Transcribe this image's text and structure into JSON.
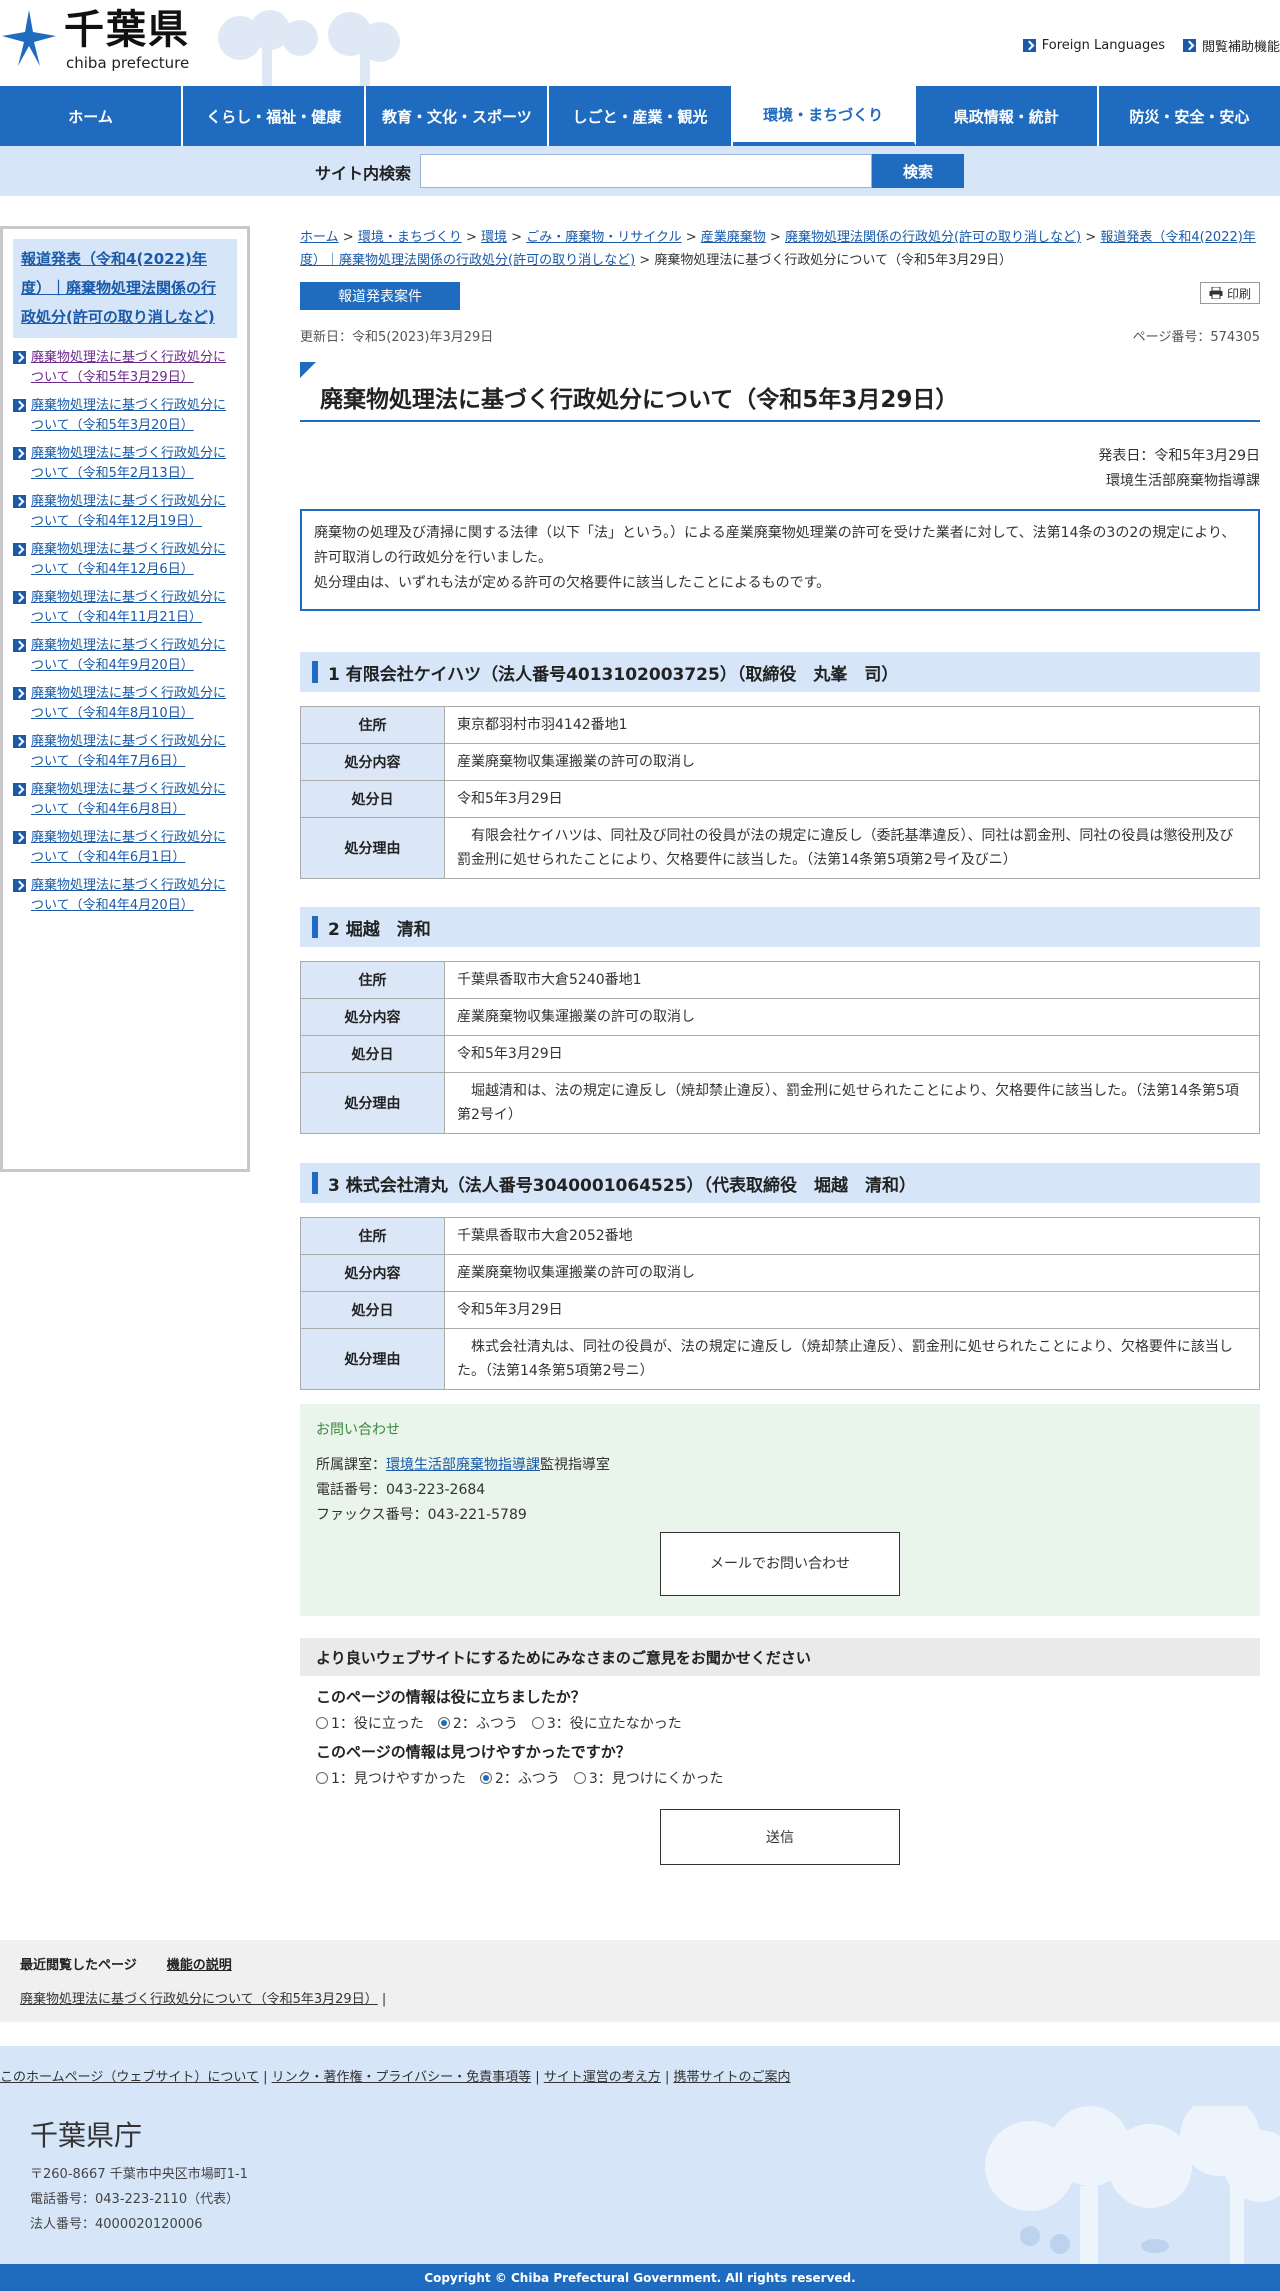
{
  "header": {
    "logo_ja": "千葉県",
    "logo_en": "chiba prefecture",
    "links": [
      "Foreign Languages",
      "閲覧補助機能"
    ]
  },
  "nav": {
    "items": [
      {
        "label": "ホーム"
      },
      {
        "label": "くらし・福祉・健康"
      },
      {
        "label": "教育・文化・スポーツ"
      },
      {
        "label": "しごと・産業・観光"
      },
      {
        "label": "環境・まちづくり"
      },
      {
        "label": "県政情報・統計"
      },
      {
        "label": "防災・安全・安心"
      }
    ]
  },
  "search": {
    "label": "サイト内検索",
    "value": "",
    "button": "検索"
  },
  "sidebar": {
    "heading": "報道発表（令和4(2022)年度）｜廃棄物処理法関係の行政処分(許可の取り消しなど)",
    "items": [
      {
        "label": "廃棄物処理法に基づく行政処分について（令和5年3月29日）"
      },
      {
        "label": "廃棄物処理法に基づく行政処分について（令和5年3月20日）"
      },
      {
        "label": "廃棄物処理法に基づく行政処分について（令和5年2月13日）"
      },
      {
        "label": "廃棄物処理法に基づく行政処分について（令和4年12月19日）"
      },
      {
        "label": "廃棄物処理法に基づく行政処分について（令和4年12月6日）"
      },
      {
        "label": "廃棄物処理法に基づく行政処分について（令和4年11月21日）"
      },
      {
        "label": "廃棄物処理法に基づく行政処分について（令和4年9月20日）"
      },
      {
        "label": "廃棄物処理法に基づく行政処分について（令和4年8月10日）"
      },
      {
        "label": "廃棄物処理法に基づく行政処分について（令和4年7月6日）"
      },
      {
        "label": "廃棄物処理法に基づく行政処分について（令和4年6月8日）"
      },
      {
        "label": "廃棄物処理法に基づく行政処分について（令和4年6月1日）"
      },
      {
        "label": "廃棄物処理法に基づく行政処分について（令和4年4月20日）"
      }
    ]
  },
  "breadcrumb": {
    "items": [
      "ホーム",
      "環境・まちづくり",
      "環境",
      "ごみ・廃棄物・リサイクル",
      "産業廃棄物",
      "廃棄物処理法関係の行政処分(許可の取り消しなど)",
      "報道発表（令和4(2022)年度）｜廃棄物処理法関係の行政処分(許可の取り消しなど)"
    ],
    "current": "廃棄物処理法に基づく行政処分について（令和5年3月29日）",
    "sep": ">"
  },
  "toolbar": {
    "tag": "報道発表案件",
    "print": "印刷"
  },
  "meta": {
    "updated": "更新日：令和5(2023)年3月29日",
    "page_no": "ページ番号：574305"
  },
  "page": {
    "title": "廃棄物処理法に基づく行政処分について（令和5年3月29日）",
    "published": "発表日：令和5年3月29日",
    "dept": "環境生活部廃棄物指導課",
    "lead": "廃棄物の処理及び清掃に関する法律（以下「法」という。）による産業廃棄物処理業の許可を受けた業者に対して、法第14条の3の2の規定により、許可取消しの行政処分を行いました。",
    "lead2": "処分理由は、いずれも法が定める許可の欠格要件に該当したことによるものです。"
  },
  "cases": [
    {
      "heading": "1 有限会社ケイハツ（法人番号4013102003725）（取締役　丸峯　司）",
      "rows": [
        {
          "k": "住所",
          "v": "東京都羽村市羽4142番地1"
        },
        {
          "k": "処分内容",
          "v": "産業廃棄物収集運搬業の許可の取消し"
        },
        {
          "k": "処分日",
          "v": "令和5年3月29日"
        },
        {
          "k": "処分理由",
          "v": "　有限会社ケイハツは、同社及び同社の役員が法の規定に違反し（委託基準違反）、同社は罰金刑、同社の役員は懲役刑及び罰金刑に処せられたことにより、欠格要件に該当した。（法第14条第5項第2号イ及びニ）"
        }
      ]
    },
    {
      "heading": "2 堀越　清和",
      "rows": [
        {
          "k": "住所",
          "v": "千葉県香取市大倉5240番地1"
        },
        {
          "k": "処分内容",
          "v": "産業廃棄物収集運搬業の許可の取消し"
        },
        {
          "k": "処分日",
          "v": "令和5年3月29日"
        },
        {
          "k": "処分理由",
          "v": "　堀越清和は、法の規定に違反し（焼却禁止違反）、罰金刑に処せられたことにより、欠格要件に該当した。（法第14条第5項第2号イ）"
        }
      ]
    },
    {
      "heading": "3 株式会社清丸（法人番号3040001064525）（代表取締役　堀越　清和）",
      "rows": [
        {
          "k": "住所",
          "v": "千葉県香取市大倉2052番地"
        },
        {
          "k": "処分内容",
          "v": "産業廃棄物収集運搬業の許可の取消し"
        },
        {
          "k": "処分日",
          "v": "令和5年3月29日"
        },
        {
          "k": "処分理由",
          "v": "　株式会社清丸は、同社の役員が、法の規定に違反し（焼却禁止違反）、罰金刑に処せられたことにより、欠格要件に該当した。（法第14条第5項第2号ニ）"
        }
      ]
    }
  ],
  "contact": {
    "heading": "お問い合わせ",
    "dept_prefix": "所属課室：",
    "dept_link": "環境生活部廃棄物指導課",
    "dept_suffix": "監視指導室",
    "tel": "電話番号：043-223-2684",
    "fax": "ファックス番号：043-221-5789",
    "mail_button": "メールでお問い合わせ"
  },
  "survey": {
    "heading": "より良いウェブサイトにするためにみなさまのご意見をお聞かせください",
    "q1": "このページの情報は役に立ちましたか？",
    "q1_opts": [
      "1：役に立った",
      "2：ふつう",
      "3：役に立たなかった"
    ],
    "q2": "このページの情報は見つけやすかったですか？",
    "q2_opts": [
      "1：見つけやすかった",
      "2：ふつう",
      "3：見つけにくかった"
    ],
    "selected_q1": 2,
    "selected_q2": 2,
    "submit": "送信"
  },
  "recent": {
    "tab": "最近閲覧したページ",
    "help": "機能の説明",
    "item": "廃棄物処理法に基づく行政処分について（令和5年3月29日）",
    "sep": "|"
  },
  "footer": {
    "links": [
      "このホームページ（ウェブサイト）について",
      "リンク・著作権・プライバシー・免責事項等",
      "サイト運営の考え方",
      "携帯サイトのご案内"
    ],
    "sep": "|",
    "name": "千葉県庁",
    "address": "〒260-8667 千葉市中央区市場町1-1",
    "tel": "電話番号：043-223-2110（代表）",
    "corp_no": "法人番号：4000020120006",
    "copyright": "Copyright © Chiba Prefectural Government. All rights reserved."
  },
  "colors": {
    "brand_blue": "#1f6bbf",
    "light_blue": "#d6e6f8",
    "contact_green": "#e9f4ea"
  }
}
